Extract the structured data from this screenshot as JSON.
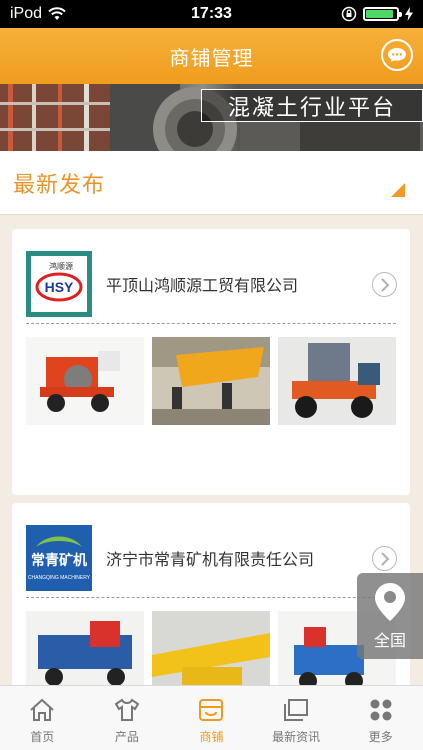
{
  "status_bar": {
    "carrier": "iPod",
    "time": "17:33",
    "battery_level": 0.9
  },
  "header": {
    "title": "商铺管理",
    "chat_icon": "chat-bubble-icon"
  },
  "banner": {
    "caption": "混凝土行业平台"
  },
  "section": {
    "title": "最新发布"
  },
  "shops": [
    {
      "name": "平顶山鸿顺源工贸有限公司",
      "logo_text": "鸿顺源"
    },
    {
      "name": "济宁市常青矿机有限责任公司",
      "logo_text": "常青矿机",
      "logo_subtext": "CHANGQING MACHINERY"
    }
  ],
  "location_float": {
    "label": "全国",
    "icon": "location-pin-icon"
  },
  "tabbar": {
    "tabs": [
      {
        "label": "首页",
        "icon": "home-icon"
      },
      {
        "label": "产品",
        "icon": "shirt-icon"
      },
      {
        "label": "商铺",
        "icon": "shop-icon"
      },
      {
        "label": "最新资讯",
        "icon": "news-icon"
      },
      {
        "label": "更多",
        "icon": "more-icon"
      }
    ],
    "active": "商铺"
  },
  "colors": {
    "accent": "#f39a24",
    "header": "#f4a62d",
    "battery": "#4cd964"
  }
}
